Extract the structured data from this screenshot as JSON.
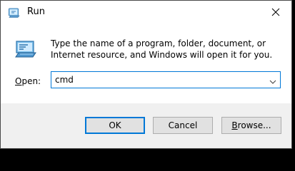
{
  "window": {
    "title": "Run",
    "title_icon": "run-icon",
    "close_icon": "close-icon"
  },
  "content": {
    "icon": "run-dialog-icon",
    "description": "Type the name of a program, folder, document, or Internet resource, and Windows will open it for you.",
    "open_label_first": "O",
    "open_label_rest": "pen:",
    "open_value": "cmd",
    "dropdown_icon": "chevron-down-icon"
  },
  "buttons": {
    "ok": "OK",
    "cancel": "Cancel",
    "browse_first": "B",
    "browse_rest": "rowse..."
  },
  "colors": {
    "accent": "#0078d7",
    "footer_bg": "#f0f0f0",
    "button_bg": "#e1e1e1"
  }
}
